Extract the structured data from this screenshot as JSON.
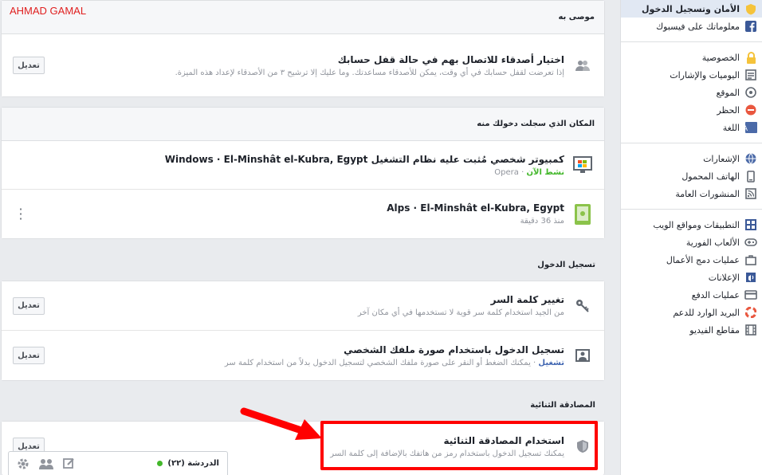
{
  "watermark": "AHMAD GAMAL",
  "recommended": {
    "title": "موصى به",
    "row": {
      "title": "اختيار أصدقاء للاتصال بهم في حالة قفل حسابك",
      "desc": "إذا تعرضت لقفل حسابك في أي وقت، يمكن للأصدقاء مساعدتك. وما عليك إلا ترشيح ٣ من الأصدقاء لإعداد هذه الميزة.",
      "button": "تعديل"
    }
  },
  "where_logged_in": {
    "title": "المكان الذي سجلت دخولك منه",
    "sessions": [
      {
        "device": "كمبيوتر شخصي مُثبت عليه نظام التشغيل Windows · El-Minshât el-Kubra, Egypt",
        "status": "نشط الآن",
        "app": "Opera"
      },
      {
        "device": "Alps · El-Minshât el-Kubra, Egypt",
        "time": "منذ 36 دقيقة"
      }
    ]
  },
  "login": {
    "title": "تسجيل الدخول",
    "rows": [
      {
        "title": "تغيير كلمة السر",
        "desc": "من الجيد استخدام كلمة سر قوية لا تستخدمها في أي مكان آخر",
        "button": "تعديل"
      },
      {
        "title": "تسجيل الدخول باستخدام صورة ملفك الشخصي",
        "status": "تشغيل",
        "desc": "يمكنك الضغط أو النقر على صورة ملفك الشخصي لتسجيل الدخول بدلاً من استخدام كلمة سر",
        "button": "تعديل"
      }
    ]
  },
  "two_factor": {
    "title": "المصادقة الثنائية",
    "row": {
      "title": "استخدام المصادقة الثنائية",
      "desc": "يمكنك تسجيل الدخول باستخدام رمز من هاتفك بالإضافة إلى كلمة السر",
      "button": "تعديل"
    }
  },
  "sidebar": {
    "groups": [
      [
        {
          "label": "الأمان وتسجيل الدخول",
          "icon": "shield-icon",
          "color": "#f5c33b",
          "active": true
        },
        {
          "label": "معلوماتك على فيسبوك",
          "icon": "facebook-icon",
          "color": "#3b5998"
        }
      ],
      [
        {
          "label": "الخصوصية",
          "icon": "lock-icon",
          "color": "#f5c33b"
        },
        {
          "label": "اليوميات والإشارات",
          "icon": "timeline-icon",
          "color": "#606770"
        },
        {
          "label": "الموقع",
          "icon": "location-icon",
          "color": "#606770"
        },
        {
          "label": "الحظر",
          "icon": "block-icon",
          "color": "#e9573f"
        },
        {
          "label": "اللغة",
          "icon": "language-icon",
          "color": "#4b6aa8"
        }
      ],
      [
        {
          "label": "الإشعارات",
          "icon": "globe-icon",
          "color": "#4b6aa8"
        },
        {
          "label": "الهاتف المحمول",
          "icon": "mobile-icon",
          "color": "#606770"
        },
        {
          "label": "المنشورات العامة",
          "icon": "rss-icon",
          "color": "#606770"
        }
      ],
      [
        {
          "label": "التطبيقات ومواقع الويب",
          "icon": "apps-icon",
          "color": "#3b5998"
        },
        {
          "label": "الألعاب الفورية",
          "icon": "gamepad-icon",
          "color": "#606770"
        },
        {
          "label": "عمليات دمج الأعمال",
          "icon": "business-icon",
          "color": "#606770"
        },
        {
          "label": "الإعلانات",
          "icon": "ads-icon",
          "color": "#3b5998"
        },
        {
          "label": "عمليات الدفع",
          "icon": "credit-card-icon",
          "color": "#606770"
        },
        {
          "label": "البريد الوارد للدعم",
          "icon": "support-icon",
          "color": "#e9573f"
        },
        {
          "label": "مقاطع الفيديو",
          "icon": "film-icon",
          "color": "#606770"
        }
      ]
    ]
  },
  "chat": {
    "label": "الدردشة (٢٢)",
    "status_color": "#42b72a"
  },
  "annotation": {
    "color": "#ff0000"
  }
}
